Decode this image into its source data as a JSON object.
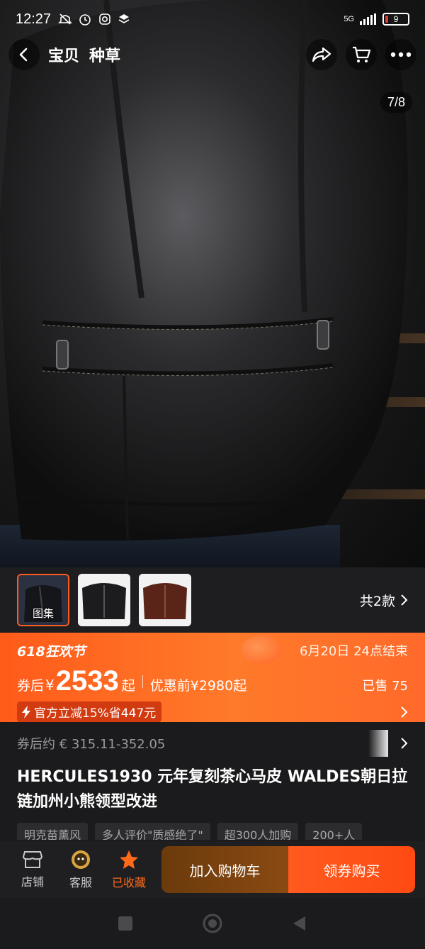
{
  "status_bar": {
    "time": "12:27",
    "network": "5G",
    "battery": "9"
  },
  "nav": {
    "tabs": [
      "宝贝",
      "种草"
    ],
    "image_counter": "7/8"
  },
  "gallery": {
    "album_label": "图集",
    "variants_label": "共2款"
  },
  "promo": {
    "festival": "618狂欢节",
    "end_time": "6月20日 24点结束",
    "after_coupon_label": "券后",
    "currency": "¥",
    "price": "2533",
    "price_suffix": "起",
    "before_discount": "优惠前¥2980起",
    "sold": "已售 75",
    "official_discount": "官方立减15%省447元"
  },
  "info": {
    "converted_price": "券后约 € 315.11-352.05",
    "title": "HERCULES1930 元年复刻茶心马皮 WALDES朝日拉链加州小熊领型改进",
    "tags": [
      "明克苗薰风",
      "多人评价\"质感绝了\"",
      "超300人加购",
      "200+人"
    ]
  },
  "actions": {
    "store": "店铺",
    "service": "客服",
    "favorited": "已收藏",
    "add_to_cart": "加入购物车",
    "buy_with_coupon": "领券购买"
  },
  "colors": {
    "accent": "#ff5a1f",
    "background": "#1b1b1d"
  },
  "icons": [
    "back-icon",
    "share-icon",
    "cart-icon",
    "more-icon",
    "chevron-right-icon",
    "lightning-icon",
    "store-icon",
    "service-icon",
    "star-icon",
    "square-icon",
    "circle-icon",
    "triangle-icon"
  ]
}
